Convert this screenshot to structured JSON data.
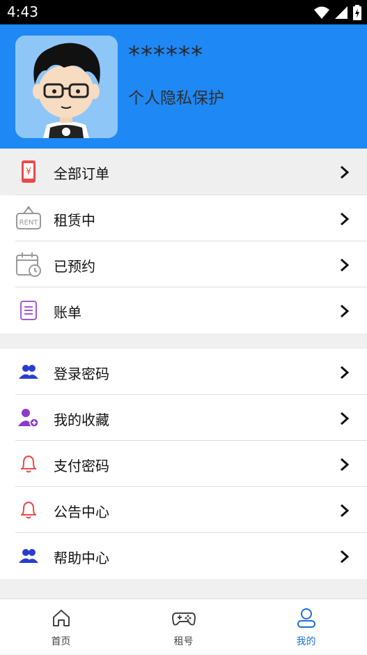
{
  "status_bar": {
    "time": "4:43"
  },
  "profile": {
    "username": "******",
    "privacy_text": "个人隐私保护"
  },
  "menu_group_1": [
    {
      "label": "全部订单",
      "icon": "yen-phone-icon"
    },
    {
      "label": "租赁中",
      "icon": "rent-sign-icon"
    },
    {
      "label": "已预约",
      "icon": "calendar-clock-icon"
    },
    {
      "label": "账单",
      "icon": "bill-icon"
    }
  ],
  "menu_group_2": [
    {
      "label": "登录密码",
      "icon": "users-icon"
    },
    {
      "label": "我的收藏",
      "icon": "user-add-icon"
    },
    {
      "label": "支付密码",
      "icon": "bell-icon"
    },
    {
      "label": "公告中心",
      "icon": "bell-icon"
    },
    {
      "label": "帮助中心",
      "icon": "users-icon"
    }
  ],
  "tabs": [
    {
      "label": "首页",
      "icon": "home-icon"
    },
    {
      "label": "租号",
      "icon": "gamepad-icon"
    },
    {
      "label": "我的",
      "icon": "person-icon"
    }
  ],
  "colors": {
    "header": "#1e88f5",
    "active_tab": "#1e6fd9"
  }
}
